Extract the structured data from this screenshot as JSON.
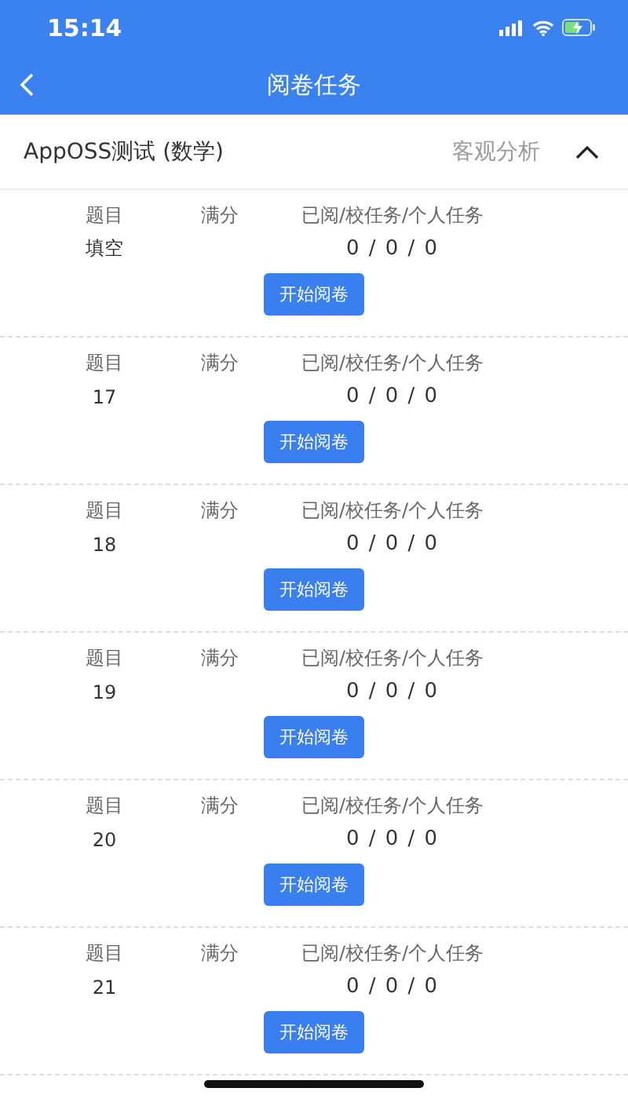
{
  "status_bar": {
    "time": "15:14"
  },
  "nav": {
    "title": "阅卷任务"
  },
  "subject": {
    "title": "AppOSS测试 (数学)",
    "action": "客观分析",
    "expanded": true
  },
  "tasks": [
    {
      "headers": [
        "题目",
        "满分",
        "已阅/校任务/个人任务"
      ],
      "question": "填空",
      "counts": "0 / 0 / 0",
      "button": "开始阅卷"
    },
    {
      "headers": [
        "题目",
        "满分",
        "已阅/校任务/个人任务"
      ],
      "question": "17",
      "counts": "0 / 0 / 0",
      "button": "开始阅卷"
    },
    {
      "headers": [
        "题目",
        "满分",
        "已阅/校任务/个人任务"
      ],
      "question": "18",
      "counts": "0 / 0 / 0",
      "button": "开始阅卷"
    },
    {
      "headers": [
        "题目",
        "满分",
        "已阅/校任务/个人任务"
      ],
      "question": "19",
      "counts": "0 / 0 / 0",
      "button": "开始阅卷"
    },
    {
      "headers": [
        "题目",
        "满分",
        "已阅/校任务/个人任务"
      ],
      "question": "20",
      "counts": "0 / 0 / 0",
      "button": "开始阅卷"
    },
    {
      "headers": [
        "题目",
        "满分",
        "已阅/校任务/个人任务"
      ],
      "question": "21",
      "counts": "0 / 0 / 0",
      "button": "开始阅卷"
    }
  ]
}
